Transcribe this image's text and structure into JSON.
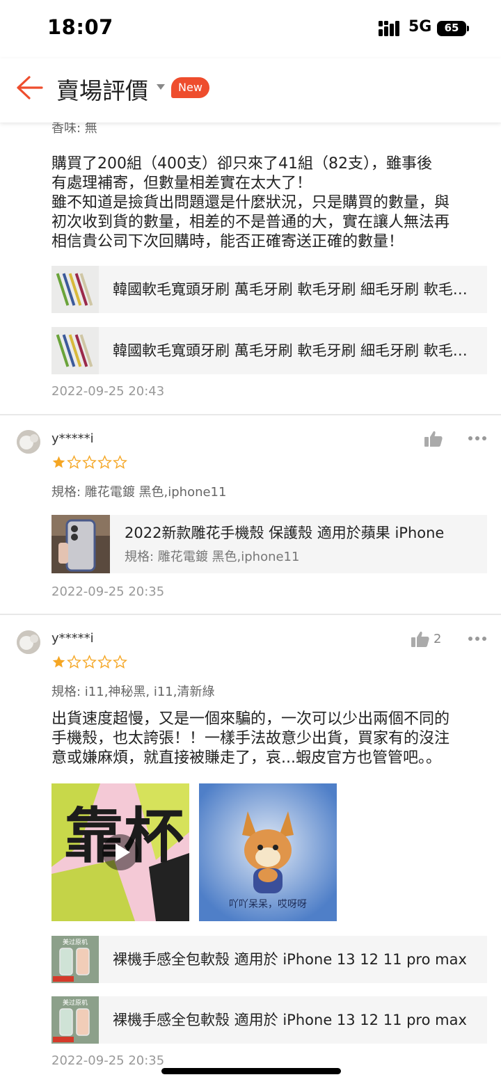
{
  "status": {
    "time": "18:07",
    "network": "5G",
    "battery": "65"
  },
  "header": {
    "title": "賣場評價",
    "badge": "New"
  },
  "colors": {
    "accent": "#ee4d2d",
    "star": "#f5a623"
  },
  "review_top": {
    "spec_partial": "香味: 無",
    "text": [
      "購買了200組（400支）卻只來了41組（82支），雖事後",
      "有處理補寄，但數量相差實在太大了！",
      "雖不知道是撿貨出問題還是什麼狀況，只是購買的數量，與",
      "初次收到貨的數量，相差的不是普通的大，實在讓人無法再",
      "相信貴公司下次回購時，能否正確寄送正確的數量！"
    ],
    "products": [
      {
        "name": "韓國軟毛寬頭牙刷 萬毛牙刷 軟毛牙刷 細毛牙刷 軟毛牙刷"
      },
      {
        "name": "韓國軟毛寬頭牙刷 萬毛牙刷 軟毛牙刷 細毛牙刷 軟毛牙刷"
      }
    ],
    "date": "2022-09-25 20:43"
  },
  "review_2": {
    "user": "y*****i",
    "rating": 1,
    "spec": "規格: 雕花電鍍 黑色,iphone11",
    "product": {
      "name": "2022新款雕花手機殼 保護殼 適用於蘋果 iPhone",
      "spec": "規格: 雕花電鍍 黑色,iphone11"
    },
    "likes": "",
    "date": "2022-09-25 20:35"
  },
  "review_3": {
    "user": "y*****i",
    "rating": 1,
    "spec": "規格: i11,神秘黑, i11,清新綠",
    "text": [
      "出貨速度超慢，又是一個來騙的，一次可以少出兩個不同的",
      "手機殼，也太誇張！！一樣手法故意少出貨，買家有的沒注",
      "意或嫌麻煩，就直接被賺走了，哀...蝦皮官方也管管吧。。"
    ],
    "media_caption": "吖吖呆呆，哎呀呀",
    "video_text": "靠杯",
    "products": [
      {
        "name": "裸機手感全包軟殼 適用於 iPhone 13 12 11 pro max",
        "thumb_text": "美过原机"
      },
      {
        "name": "裸機手感全包軟殼 適用於 iPhone 13 12 11 pro max",
        "thumb_text": "美过原机"
      }
    ],
    "likes": "2",
    "date": "2022-09-25 20:35"
  }
}
